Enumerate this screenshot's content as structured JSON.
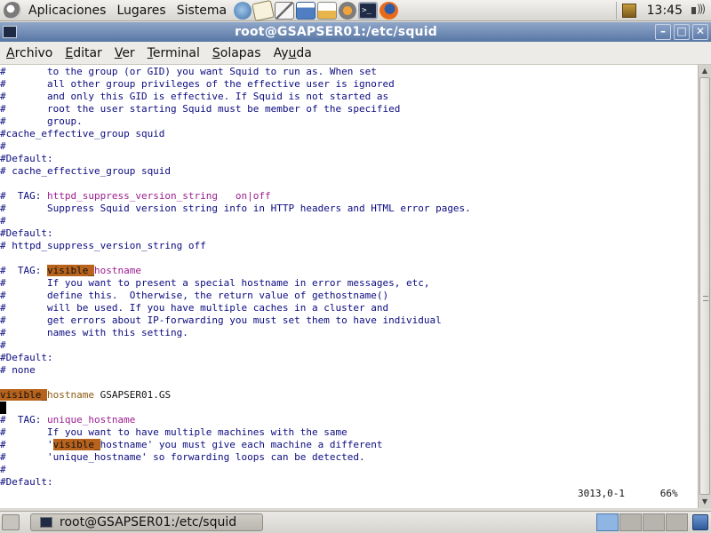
{
  "panel": {
    "menus": [
      "Aplicaciones",
      "Lugares",
      "Sistema"
    ],
    "clock": "13:45"
  },
  "window": {
    "title": "root@GSAPSER01:/etc/squid"
  },
  "menubar": {
    "items": [
      {
        "m": "A",
        "rest": "rchivo"
      },
      {
        "m": "E",
        "rest": "ditar"
      },
      {
        "m": "V",
        "rest": "er"
      },
      {
        "m": "T",
        "rest": "erminal"
      },
      {
        "m": "S",
        "rest": "olapas"
      },
      {
        "m": "",
        "rest": "Ay",
        "m2": "u",
        "rest2": "da"
      }
    ]
  },
  "terminal": {
    "lines": [
      [
        "#       to the group (or GID) you want Squid to run as. When set"
      ],
      [
        "#       all other group privileges of the effective user is ignored"
      ],
      [
        "#       and only this GID is effective. If Squid is not started as"
      ],
      [
        "#       root the user starting Squid must be member of the specified"
      ],
      [
        "#       group."
      ],
      [
        "#cache_effective_group squid"
      ],
      [
        "#"
      ],
      [
        "#Default:"
      ],
      [
        "# cache_effective_group squid"
      ],
      [
        ""
      ],
      [
        "#  TAG: ",
        "httpd_suppress_version_string   on|off"
      ],
      [
        "#       Suppress Squid version string info in HTTP headers and HTML error pages."
      ],
      [
        "#"
      ],
      [
        "#Default:"
      ],
      [
        "# httpd_suppress_version_string off"
      ],
      [
        ""
      ],
      [
        "#  TAG: ",
        "visible_",
        "hostname"
      ],
      [
        "#       If you want to present a special hostname in error messages, etc,"
      ],
      [
        "#       define this.  Otherwise, the return value of gethostname()"
      ],
      [
        "#       will be used. If you have multiple caches in a cluster and"
      ],
      [
        "#       get errors about IP-forwarding you must set them to have individual"
      ],
      [
        "#       names with this setting."
      ],
      [
        "#"
      ],
      [
        "#Default:"
      ],
      [
        "# none"
      ],
      [
        ""
      ],
      [
        "visible_",
        "hostname",
        " GSAPSER01.GS"
      ],
      [
        ""
      ],
      [
        "#  TAG: ",
        "unique_hostname"
      ],
      [
        "#       If you want to have multiple machines with the same"
      ],
      [
        "#       '",
        "visible_",
        "hostname' you must give each machine a different"
      ],
      [
        "#       'unique_hostname' so forwarding loops can be detected."
      ],
      [
        "#"
      ],
      [
        "#Default:"
      ]
    ],
    "status_position": "3013,0-1",
    "status_percent": "66%"
  },
  "taskbar": {
    "task_label": "root@GSAPSER01:/etc/squid"
  }
}
